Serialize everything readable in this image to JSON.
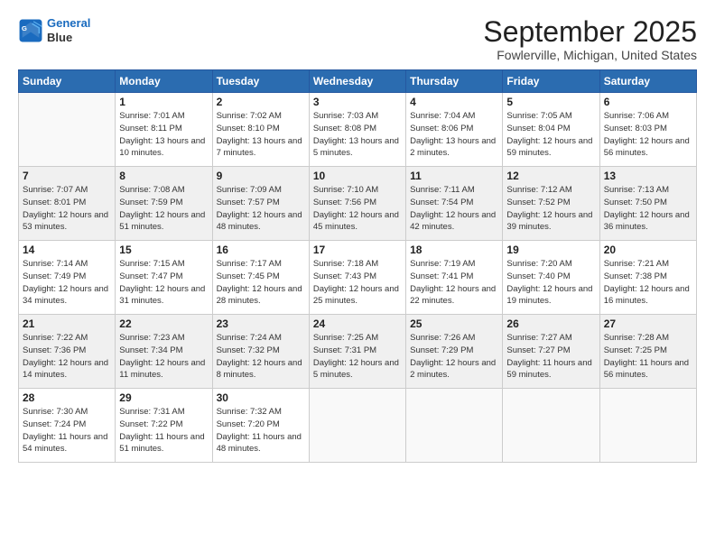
{
  "header": {
    "logo_line1": "General",
    "logo_line2": "Blue",
    "month": "September 2025",
    "location": "Fowlerville, Michigan, United States"
  },
  "weekdays": [
    "Sunday",
    "Monday",
    "Tuesday",
    "Wednesday",
    "Thursday",
    "Friday",
    "Saturday"
  ],
  "weeks": [
    [
      {
        "day": "",
        "sunrise": "",
        "sunset": "",
        "daylight": ""
      },
      {
        "day": "1",
        "sunrise": "Sunrise: 7:01 AM",
        "sunset": "Sunset: 8:11 PM",
        "daylight": "Daylight: 13 hours and 10 minutes."
      },
      {
        "day": "2",
        "sunrise": "Sunrise: 7:02 AM",
        "sunset": "Sunset: 8:10 PM",
        "daylight": "Daylight: 13 hours and 7 minutes."
      },
      {
        "day": "3",
        "sunrise": "Sunrise: 7:03 AM",
        "sunset": "Sunset: 8:08 PM",
        "daylight": "Daylight: 13 hours and 5 minutes."
      },
      {
        "day": "4",
        "sunrise": "Sunrise: 7:04 AM",
        "sunset": "Sunset: 8:06 PM",
        "daylight": "Daylight: 13 hours and 2 minutes."
      },
      {
        "day": "5",
        "sunrise": "Sunrise: 7:05 AM",
        "sunset": "Sunset: 8:04 PM",
        "daylight": "Daylight: 12 hours and 59 minutes."
      },
      {
        "day": "6",
        "sunrise": "Sunrise: 7:06 AM",
        "sunset": "Sunset: 8:03 PM",
        "daylight": "Daylight: 12 hours and 56 minutes."
      }
    ],
    [
      {
        "day": "7",
        "sunrise": "Sunrise: 7:07 AM",
        "sunset": "Sunset: 8:01 PM",
        "daylight": "Daylight: 12 hours and 53 minutes."
      },
      {
        "day": "8",
        "sunrise": "Sunrise: 7:08 AM",
        "sunset": "Sunset: 7:59 PM",
        "daylight": "Daylight: 12 hours and 51 minutes."
      },
      {
        "day": "9",
        "sunrise": "Sunrise: 7:09 AM",
        "sunset": "Sunset: 7:57 PM",
        "daylight": "Daylight: 12 hours and 48 minutes."
      },
      {
        "day": "10",
        "sunrise": "Sunrise: 7:10 AM",
        "sunset": "Sunset: 7:56 PM",
        "daylight": "Daylight: 12 hours and 45 minutes."
      },
      {
        "day": "11",
        "sunrise": "Sunrise: 7:11 AM",
        "sunset": "Sunset: 7:54 PM",
        "daylight": "Daylight: 12 hours and 42 minutes."
      },
      {
        "day": "12",
        "sunrise": "Sunrise: 7:12 AM",
        "sunset": "Sunset: 7:52 PM",
        "daylight": "Daylight: 12 hours and 39 minutes."
      },
      {
        "day": "13",
        "sunrise": "Sunrise: 7:13 AM",
        "sunset": "Sunset: 7:50 PM",
        "daylight": "Daylight: 12 hours and 36 minutes."
      }
    ],
    [
      {
        "day": "14",
        "sunrise": "Sunrise: 7:14 AM",
        "sunset": "Sunset: 7:49 PM",
        "daylight": "Daylight: 12 hours and 34 minutes."
      },
      {
        "day": "15",
        "sunrise": "Sunrise: 7:15 AM",
        "sunset": "Sunset: 7:47 PM",
        "daylight": "Daylight: 12 hours and 31 minutes."
      },
      {
        "day": "16",
        "sunrise": "Sunrise: 7:17 AM",
        "sunset": "Sunset: 7:45 PM",
        "daylight": "Daylight: 12 hours and 28 minutes."
      },
      {
        "day": "17",
        "sunrise": "Sunrise: 7:18 AM",
        "sunset": "Sunset: 7:43 PM",
        "daylight": "Daylight: 12 hours and 25 minutes."
      },
      {
        "day": "18",
        "sunrise": "Sunrise: 7:19 AM",
        "sunset": "Sunset: 7:41 PM",
        "daylight": "Daylight: 12 hours and 22 minutes."
      },
      {
        "day": "19",
        "sunrise": "Sunrise: 7:20 AM",
        "sunset": "Sunset: 7:40 PM",
        "daylight": "Daylight: 12 hours and 19 minutes."
      },
      {
        "day": "20",
        "sunrise": "Sunrise: 7:21 AM",
        "sunset": "Sunset: 7:38 PM",
        "daylight": "Daylight: 12 hours and 16 minutes."
      }
    ],
    [
      {
        "day": "21",
        "sunrise": "Sunrise: 7:22 AM",
        "sunset": "Sunset: 7:36 PM",
        "daylight": "Daylight: 12 hours and 14 minutes."
      },
      {
        "day": "22",
        "sunrise": "Sunrise: 7:23 AM",
        "sunset": "Sunset: 7:34 PM",
        "daylight": "Daylight: 12 hours and 11 minutes."
      },
      {
        "day": "23",
        "sunrise": "Sunrise: 7:24 AM",
        "sunset": "Sunset: 7:32 PM",
        "daylight": "Daylight: 12 hours and 8 minutes."
      },
      {
        "day": "24",
        "sunrise": "Sunrise: 7:25 AM",
        "sunset": "Sunset: 7:31 PM",
        "daylight": "Daylight: 12 hours and 5 minutes."
      },
      {
        "day": "25",
        "sunrise": "Sunrise: 7:26 AM",
        "sunset": "Sunset: 7:29 PM",
        "daylight": "Daylight: 12 hours and 2 minutes."
      },
      {
        "day": "26",
        "sunrise": "Sunrise: 7:27 AM",
        "sunset": "Sunset: 7:27 PM",
        "daylight": "Daylight: 11 hours and 59 minutes."
      },
      {
        "day": "27",
        "sunrise": "Sunrise: 7:28 AM",
        "sunset": "Sunset: 7:25 PM",
        "daylight": "Daylight: 11 hours and 56 minutes."
      }
    ],
    [
      {
        "day": "28",
        "sunrise": "Sunrise: 7:30 AM",
        "sunset": "Sunset: 7:24 PM",
        "daylight": "Daylight: 11 hours and 54 minutes."
      },
      {
        "day": "29",
        "sunrise": "Sunrise: 7:31 AM",
        "sunset": "Sunset: 7:22 PM",
        "daylight": "Daylight: 11 hours and 51 minutes."
      },
      {
        "day": "30",
        "sunrise": "Sunrise: 7:32 AM",
        "sunset": "Sunset: 7:20 PM",
        "daylight": "Daylight: 11 hours and 48 minutes."
      },
      {
        "day": "",
        "sunrise": "",
        "sunset": "",
        "daylight": ""
      },
      {
        "day": "",
        "sunrise": "",
        "sunset": "",
        "daylight": ""
      },
      {
        "day": "",
        "sunrise": "",
        "sunset": "",
        "daylight": ""
      },
      {
        "day": "",
        "sunrise": "",
        "sunset": "",
        "daylight": ""
      }
    ]
  ]
}
